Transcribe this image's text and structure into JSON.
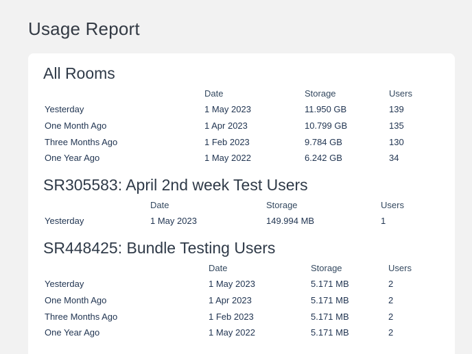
{
  "page_title": "Usage Report",
  "sections": [
    {
      "title": "All Rooms",
      "headers": {
        "date": "Date",
        "storage": "Storage",
        "users": "Users"
      },
      "rows": [
        {
          "period": "Yesterday",
          "date": "1 May 2023",
          "storage": "11.950 GB",
          "users": "139"
        },
        {
          "period": "One Month Ago",
          "date": "1 Apr 2023",
          "storage": "10.799 GB",
          "users": "135"
        },
        {
          "period": "Three Months Ago",
          "date": "1 Feb 2023",
          "storage": "9.784 GB",
          "users": "130"
        },
        {
          "period": "One Year Ago",
          "date": "1 May 2022",
          "storage": "6.242 GB",
          "users": "34"
        }
      ]
    },
    {
      "title": "SR305583: April 2nd week Test Users",
      "headers": {
        "date": "Date",
        "storage": "Storage",
        "users": "Users"
      },
      "rows": [
        {
          "period": "Yesterday",
          "date": "1 May 2023",
          "storage": "149.994 MB",
          "users": "1"
        }
      ]
    },
    {
      "title": "SR448425: Bundle Testing Users",
      "headers": {
        "date": "Date",
        "storage": "Storage",
        "users": "Users"
      },
      "rows": [
        {
          "period": "Yesterday",
          "date": "1 May 2023",
          "storage": "5.171 MB",
          "users": "2"
        },
        {
          "period": "One Month Ago",
          "date": "1 Apr 2023",
          "storage": "5.171 MB",
          "users": "2"
        },
        {
          "period": "Three Months Ago",
          "date": "1 Feb 2023",
          "storage": "5.171 MB",
          "users": "2"
        },
        {
          "period": "One Year Ago",
          "date": "1 May 2022",
          "storage": "5.171 MB",
          "users": "2"
        }
      ]
    }
  ]
}
